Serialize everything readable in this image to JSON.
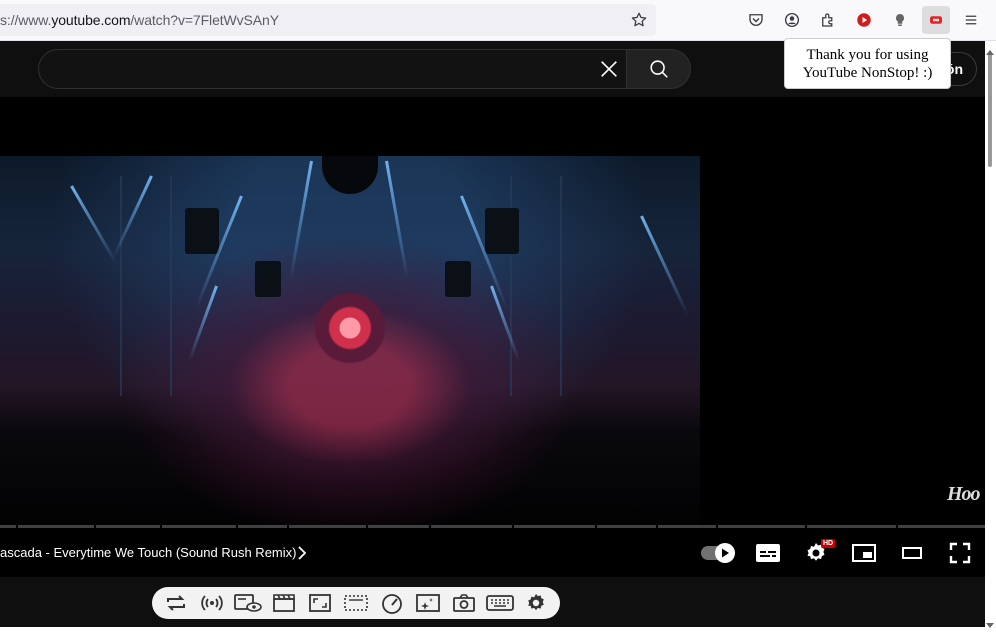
{
  "browser": {
    "url_prefix": "s://www.",
    "url_domain": "youtube.com",
    "url_path": "/watch?v=7FletWvSAnY",
    "icons": [
      "bookmark-star-icon",
      "pocket-icon",
      "account-icon",
      "extensions-icon",
      "youtube-red-icon",
      "lightbulb-icon",
      "nonstop-extension-icon",
      "menu-icon"
    ]
  },
  "youtube": {
    "search_value": "",
    "signin_partial": "ón",
    "tooltip_line1": "Thank you for using",
    "tooltip_line2": "YouTube NonStop! :)",
    "watermark": "Hoo",
    "video_title": "ascada - Everytime We Touch (Sound Rush Remix)",
    "hd_badge": "HD"
  },
  "colors": {
    "yt_bg": "#0f0f0f",
    "hd_red": "#cc0000",
    "nonstop_red": "#e0242a",
    "yt_red": "#d01c1c"
  }
}
